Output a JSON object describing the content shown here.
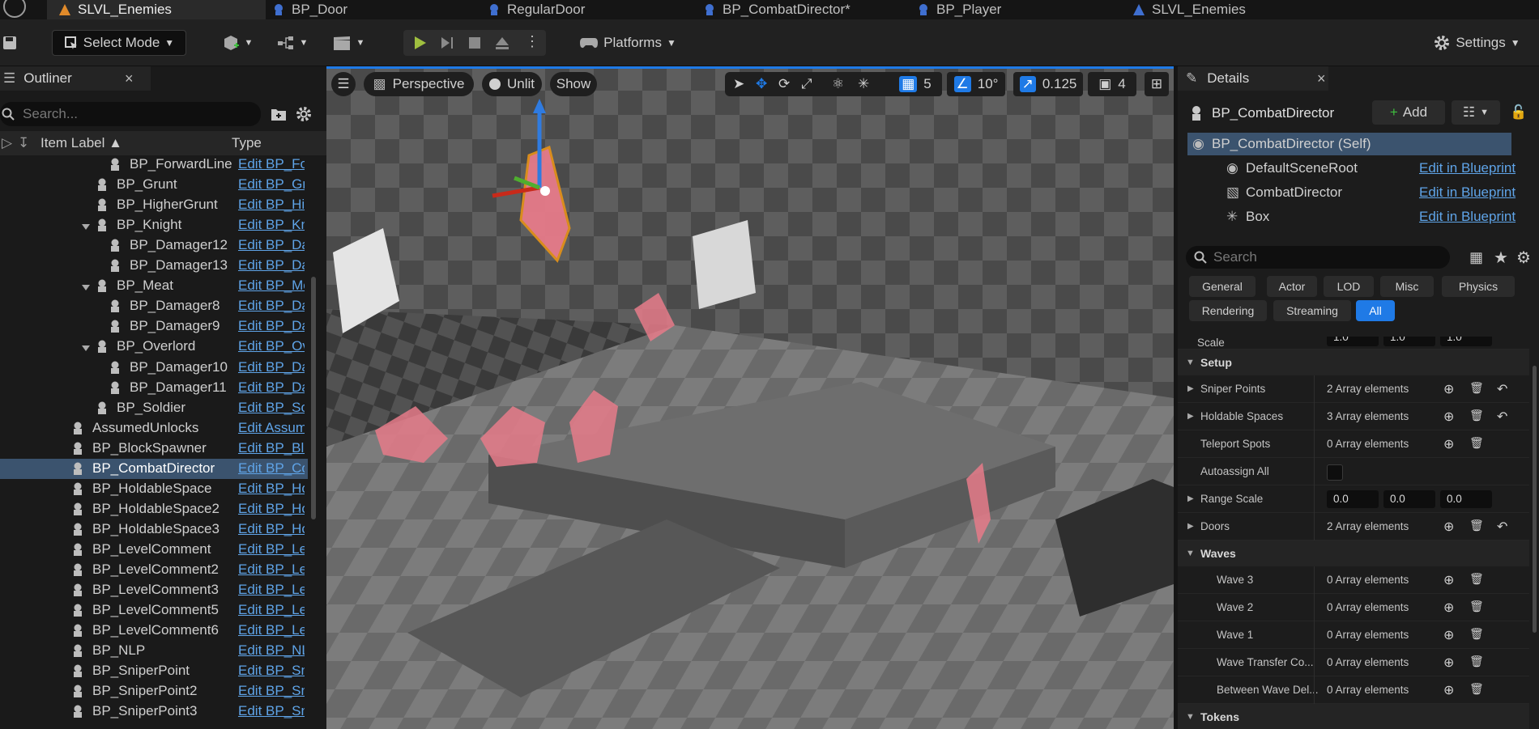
{
  "tabs": [
    {
      "label": "SLVL_Enemies",
      "icon": "level-icon",
      "active": true
    },
    {
      "label": "BP_Door",
      "icon": "blueprint-icon"
    },
    {
      "label": "RegularDoor",
      "icon": "blueprint-icon"
    },
    {
      "label": "BP_CombatDirector*",
      "icon": "blueprint-icon"
    },
    {
      "label": "BP_Player",
      "icon": "blueprint-icon"
    },
    {
      "label": "SLVL_Enemies",
      "icon": "level-icon"
    }
  ],
  "toolbar": {
    "select_mode": "Select Mode",
    "platforms": "Platforms",
    "settings": "Settings"
  },
  "outliner": {
    "tab_label": "Outliner",
    "search_placeholder": "Search...",
    "col_label": "Item Label",
    "col_type": "Type",
    "rows": [
      {
        "label": "BP_ForwardLine",
        "edit": "Edit BP_Fo"
      },
      {
        "label": "BP_Grunt",
        "edit": "Edit BP_Gr"
      },
      {
        "label": "BP_HigherGrunt",
        "edit": "Edit BP_Hi"
      },
      {
        "label": "BP_Knight",
        "edit": "Edit BP_Kn"
      },
      {
        "label": "BP_Damager12",
        "edit": "Edit BP_Da"
      },
      {
        "label": "BP_Damager13",
        "edit": "Edit BP_Da"
      },
      {
        "label": "BP_Meat",
        "edit": "Edit BP_Me"
      },
      {
        "label": "BP_Damager8",
        "edit": "Edit BP_Da"
      },
      {
        "label": "BP_Damager9",
        "edit": "Edit BP_Da"
      },
      {
        "label": "BP_Overlord",
        "edit": "Edit BP_Ov"
      },
      {
        "label": "BP_Damager10",
        "edit": "Edit BP_Da"
      },
      {
        "label": "BP_Damager11",
        "edit": "Edit BP_Da"
      },
      {
        "label": "BP_Soldier",
        "edit": "Edit BP_So"
      },
      {
        "label": "AssumedUnlocks",
        "edit": "Edit Assum"
      },
      {
        "label": "BP_BlockSpawner",
        "edit": "Edit BP_Blo"
      },
      {
        "label": "BP_CombatDirector",
        "edit": "Edit BP_Co"
      },
      {
        "label": "BP_HoldableSpace",
        "edit": "Edit BP_Ho"
      },
      {
        "label": "BP_HoldableSpace2",
        "edit": "Edit BP_Ho"
      },
      {
        "label": "BP_HoldableSpace3",
        "edit": "Edit BP_Ho"
      },
      {
        "label": "BP_LevelComment",
        "edit": "Edit BP_Le"
      },
      {
        "label": "BP_LevelComment2",
        "edit": "Edit BP_Le"
      },
      {
        "label": "BP_LevelComment3",
        "edit": "Edit BP_Le"
      },
      {
        "label": "BP_LevelComment5",
        "edit": "Edit BP_Le"
      },
      {
        "label": "BP_LevelComment6",
        "edit": "Edit BP_Le"
      },
      {
        "label": "BP_NLP",
        "edit": "Edit BP_NL"
      },
      {
        "label": "BP_SniperPoint",
        "edit": "Edit BP_Sn"
      },
      {
        "label": "BP_SniperPoint2",
        "edit": "Edit BP_Sn"
      },
      {
        "label": "BP_SniperPoint3",
        "edit": "Edit BP_Sn"
      }
    ]
  },
  "viewport": {
    "perspective": "Perspective",
    "unlit": "Unlit",
    "show": "Show",
    "grid_snap": "5",
    "rotation_snap": "10°",
    "scale_snap": "0.125",
    "camera_speed": "4",
    "accent": "#1f7ae6"
  },
  "details": {
    "tab_label": "Details",
    "object_name": "BP_CombatDirector",
    "add_label": "Add",
    "components": [
      {
        "name": "BP_CombatDirector (Self)",
        "link": ""
      },
      {
        "name": "DefaultSceneRoot",
        "link": "Edit in Blueprint"
      },
      {
        "name": "CombatDirector",
        "link": "Edit in Blueprint"
      },
      {
        "name": "Box",
        "link": "Edit in Blueprint"
      }
    ],
    "search_placeholder": "Search",
    "filters_row1": [
      "General",
      "Actor",
      "LOD",
      "Misc",
      "Physics"
    ],
    "filters_row2": [
      "Rendering",
      "Streaming",
      "All"
    ],
    "partial_row_label": "Scale",
    "partial_row_values": [
      "1.0",
      "1.0",
      "1.0"
    ],
    "section_setup": "Setup",
    "setup_props": [
      {
        "name": "Sniper Points",
        "value": "2 Array elements"
      },
      {
        "name": "Holdable Spaces",
        "value": "3 Array elements"
      },
      {
        "name": "Teleport Spots",
        "value": "0 Array elements"
      },
      {
        "name": "Autoassign All",
        "value": ""
      },
      {
        "name": "Range Scale",
        "value": ""
      },
      {
        "name": "Doors",
        "value": "2 Array elements"
      }
    ],
    "range_scale_values": [
      "0.0",
      "0.0",
      "0.0"
    ],
    "section_waves": "Waves",
    "wave_props": [
      {
        "name": "Wave 3",
        "value": "0 Array elements"
      },
      {
        "name": "Wave 2",
        "value": "0 Array elements"
      },
      {
        "name": "Wave 1",
        "value": "0 Array elements"
      },
      {
        "name": "Wave Transfer Co...",
        "value": "0 Array elements"
      },
      {
        "name": "Between Wave Del...",
        "value": "0 Array elements"
      }
    ],
    "section_tokens": "Tokens"
  }
}
